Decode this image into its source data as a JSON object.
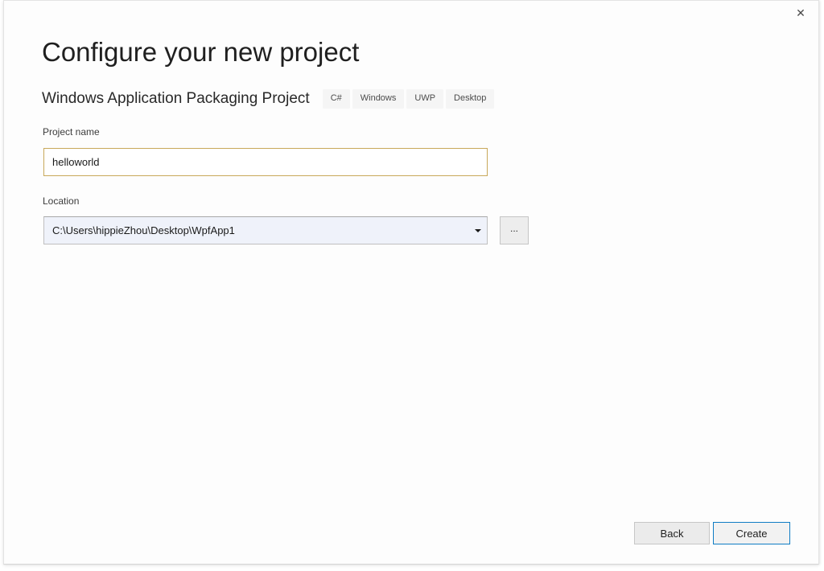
{
  "window": {
    "close_label": "✕",
    "close_icon": "close-icon"
  },
  "header": {
    "title": "Configure your new project",
    "template_name": "Windows Application Packaging Project",
    "tags": [
      "C#",
      "Windows",
      "UWP",
      "Desktop"
    ]
  },
  "fields": {
    "project_name": {
      "label": "Project name",
      "value": "helloworld",
      "placeholder": ""
    },
    "location": {
      "label": "Location",
      "value": "C:\\Users\\hippieZhou\\Desktop\\WpfApp1",
      "dropdown_icon": "chevron-down-icon",
      "browse_label": "..."
    }
  },
  "footer": {
    "back_label": "Back",
    "create_label": "Create"
  },
  "colors": {
    "accent": "#0f7cc4",
    "focus_border": "#c8a85a",
    "dialog_background": "#fdfdfd",
    "combo_background": "#eff2fa",
    "tag_background": "#f5f5f5"
  }
}
